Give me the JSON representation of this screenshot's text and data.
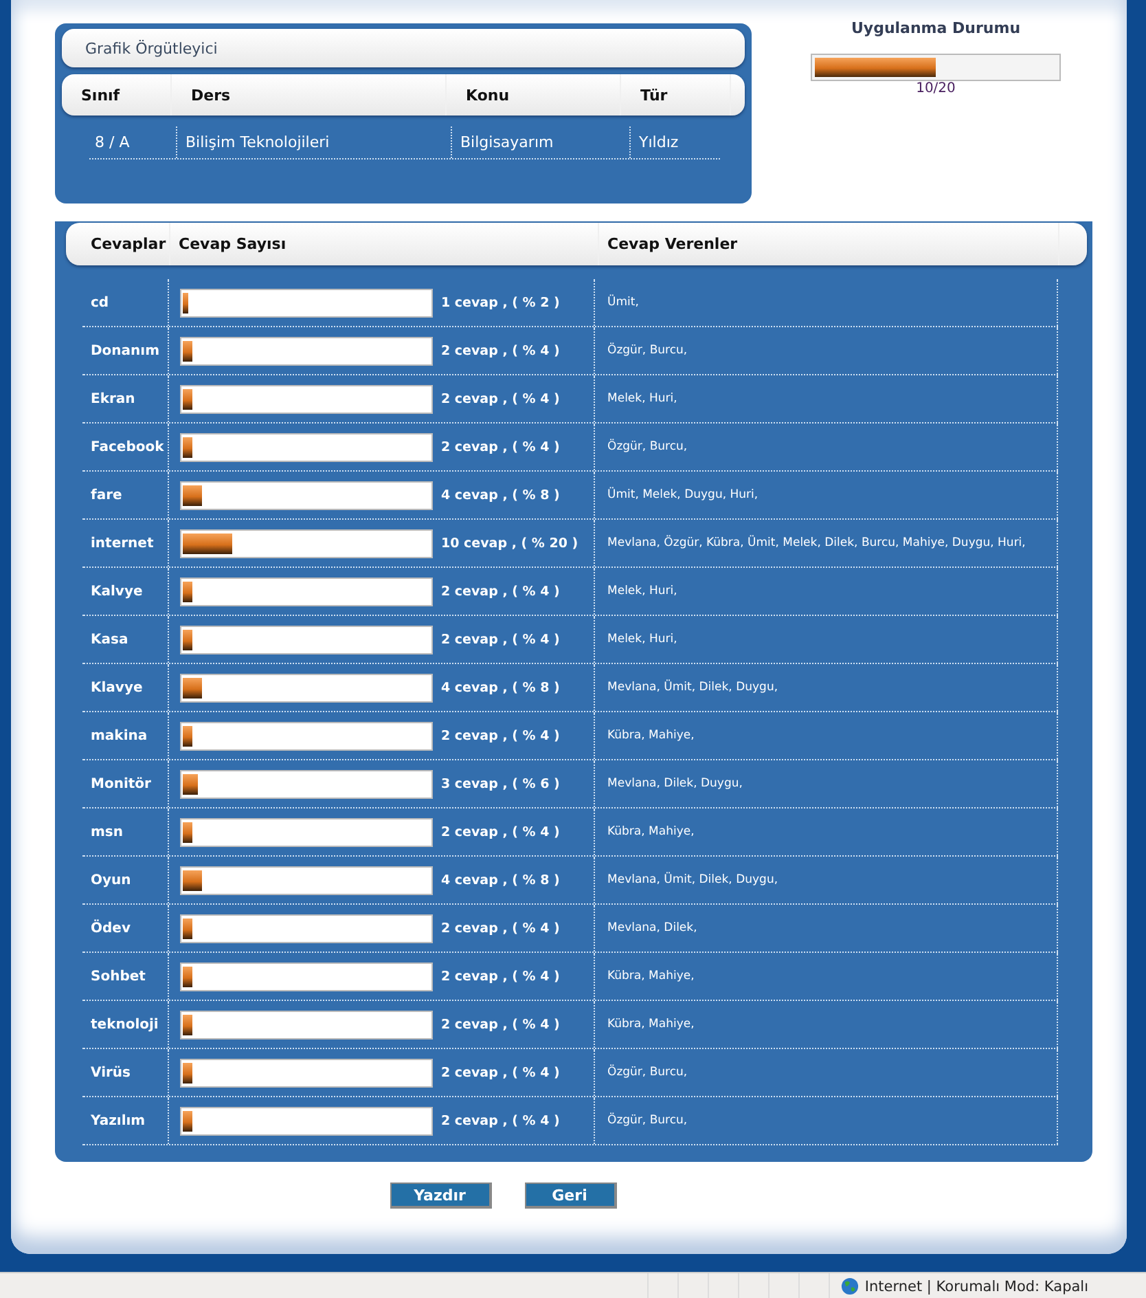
{
  "info_panel": {
    "title": "Grafik Örgütleyici",
    "columns": [
      "Sınıf",
      "Ders",
      "Konu",
      "Tür"
    ],
    "row": [
      "8 / A",
      "Bilişim Teknolojileri",
      "Bilgisayarım",
      "Yıldız"
    ]
  },
  "progress": {
    "title": "Uygulanma Durumu",
    "level": 0.5,
    "reading": "10/20"
  },
  "answers": {
    "columns": [
      "Cevaplar",
      "Cevap Sayısı",
      "Cevap Verenler"
    ],
    "rows": [
      {
        "answer": "cd",
        "level": 0.02,
        "count": "1 cevap , ( % 2 )",
        "respondents": "Ümit,"
      },
      {
        "answer": "Donanım",
        "level": 0.04,
        "count": "2 cevap , ( % 4 )",
        "respondents": "Özgür, Burcu,"
      },
      {
        "answer": "Ekran",
        "level": 0.04,
        "count": "2 cevap , ( % 4 )",
        "respondents": "Melek, Huri,"
      },
      {
        "answer": "Facebook",
        "level": 0.04,
        "count": "2 cevap , ( % 4 )",
        "respondents": "Özgür, Burcu,"
      },
      {
        "answer": "fare",
        "level": 0.08,
        "count": "4 cevap , ( % 8 )",
        "respondents": "Ümit, Melek, Duygu, Huri,"
      },
      {
        "answer": "internet",
        "level": 0.2,
        "count": "10 cevap , ( % 20 )",
        "respondents": "Mevlana, Özgür, Kübra, Ümit, Melek, Dilek, Burcu, Mahiye, Duygu, Huri,"
      },
      {
        "answer": "Kalvye",
        "level": 0.04,
        "count": "2 cevap , ( % 4 )",
        "respondents": "Melek, Huri,"
      },
      {
        "answer": "Kasa",
        "level": 0.04,
        "count": "2 cevap , ( % 4 )",
        "respondents": "Melek, Huri,"
      },
      {
        "answer": "Klavye",
        "level": 0.08,
        "count": "4 cevap , ( % 8 )",
        "respondents": "Mevlana, Ümit, Dilek, Duygu,"
      },
      {
        "answer": "makina",
        "level": 0.04,
        "count": "2 cevap , ( % 4 )",
        "respondents": "Kübra, Mahiye,"
      },
      {
        "answer": "Monitör",
        "level": 0.06,
        "count": "3 cevap , ( % 6 )",
        "respondents": "Mevlana, Dilek, Duygu,"
      },
      {
        "answer": "msn",
        "level": 0.04,
        "count": "2 cevap , ( % 4 )",
        "respondents": "Kübra, Mahiye,"
      },
      {
        "answer": "Oyun",
        "level": 0.08,
        "count": "4 cevap , ( % 8 )",
        "respondents": "Mevlana, Ümit, Dilek, Duygu,"
      },
      {
        "answer": "Ödev",
        "level": 0.04,
        "count": "2 cevap , ( % 4 )",
        "respondents": "Mevlana, Dilek,"
      },
      {
        "answer": "Sohbet",
        "level": 0.04,
        "count": "2 cevap , ( % 4 )",
        "respondents": "Kübra, Mahiye,"
      },
      {
        "answer": "teknoloji",
        "level": 0.04,
        "count": "2 cevap , ( % 4 )",
        "respondents": "Kübra, Mahiye,"
      },
      {
        "answer": "Virüs",
        "level": 0.04,
        "count": "2 cevap , ( % 4 )",
        "respondents": "Özgür, Burcu,"
      },
      {
        "answer": "Yazılım",
        "level": 0.04,
        "count": "2 cevap , ( % 4 )",
        "respondents": "Özgür, Burcu,"
      }
    ]
  },
  "buttons": [
    "Yazdır",
    "Geri"
  ],
  "status_bar": {
    "text": "Internet | Korumalı Mod: Kapalı"
  }
}
